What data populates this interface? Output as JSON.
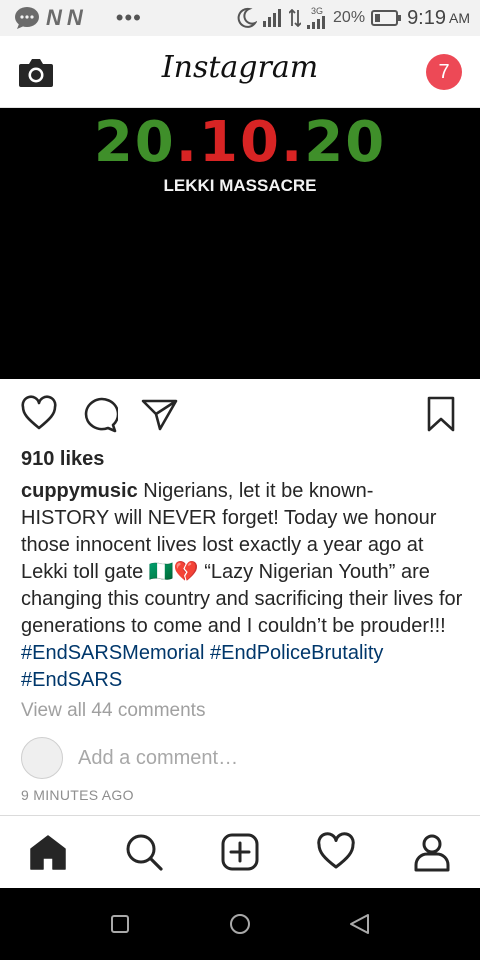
{
  "status_bar": {
    "notification_icons": [
      "chat-bubble-icon",
      "n-app-icon",
      "n-app-icon"
    ],
    "app_icon_letters": [
      "N",
      "N"
    ],
    "more_indicator": "•••",
    "network_type": "3G",
    "battery_percent": "20%",
    "time": "9:19",
    "ampm": "AM"
  },
  "header": {
    "logo": "Instagram",
    "notification_count": "7",
    "colors": {
      "badge": "#ed4956"
    }
  },
  "post": {
    "image": {
      "date_parts": [
        "20",
        ".10.",
        "20"
      ],
      "subtitle": "LEKKI MASSACRE",
      "colors": {
        "green": "#3f8f2a",
        "red": "#d82424",
        "background": "#000000"
      }
    },
    "likes": "910 likes",
    "username": "cuppymusic",
    "caption": "Nigerians, let it be known- HISTORY will NEVER forget! Today we honour those innocent lives lost exactly a year ago at Lekki toll gate 🇳🇬💔 “Lazy Nigerian Youth” are changing this country and sacrificing their lives for generations to come and I couldn’t be prouder!!!",
    "hashtags": [
      "#EndSARSMemorial",
      "#EndPoliceBrutality",
      "#EndSARS"
    ],
    "view_comments": "View all 44 comments",
    "comment_placeholder": "Add a comment…",
    "time_ago": "9 MINUTES AGO"
  },
  "actions": [
    "heart-icon",
    "comment-icon",
    "share-icon",
    "bookmark-icon"
  ],
  "bottom_nav": [
    "home-icon",
    "search-icon",
    "add-post-icon",
    "activity-heart-icon",
    "profile-icon"
  ],
  "android_nav": [
    "recents-square-icon",
    "home-circle-icon",
    "back-triangle-icon"
  ]
}
